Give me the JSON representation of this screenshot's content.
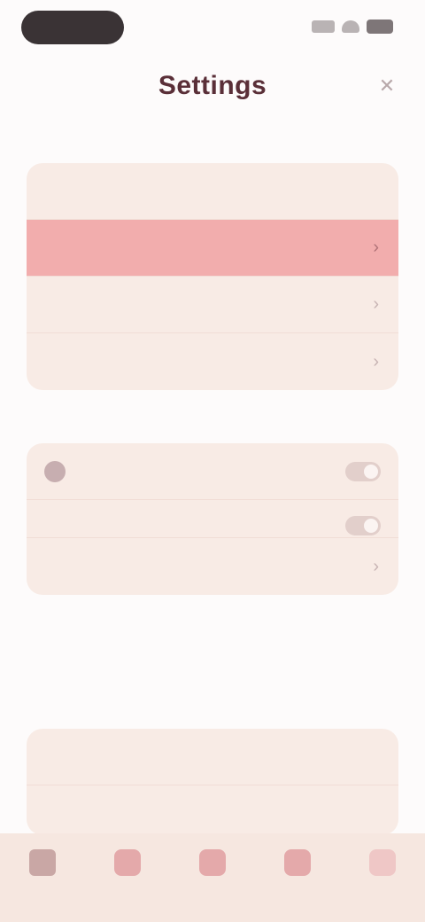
{
  "header": {
    "title": "Settings",
    "action_icon": "close-icon"
  },
  "sections": {
    "account": {
      "label": "",
      "rows": [
        {
          "label": "",
          "icon": ""
        },
        {
          "label": "",
          "selected": true
        },
        {
          "label": ""
        },
        {
          "label": ""
        }
      ]
    },
    "preferences": {
      "label": "",
      "rows": [
        {
          "label": ""
        },
        {
          "label": "",
          "desc": ""
        },
        {
          "label": ""
        }
      ]
    },
    "about": {
      "label": "",
      "rows": [
        {
          "label": "",
          "value": ""
        },
        {
          "label": ""
        }
      ]
    }
  },
  "bottom_nav": {
    "items": [
      {
        "label": "",
        "icon": "home-icon"
      },
      {
        "label": "",
        "icon": "calendar-icon"
      },
      {
        "label": "",
        "icon": "add-icon"
      },
      {
        "label": "",
        "icon": "chat-icon"
      },
      {
        "label": "",
        "icon": "profile-icon"
      }
    ]
  },
  "colors": {
    "accent": "#f2adad",
    "card_bg": "#f8ebe5",
    "title": "#5a2f38"
  }
}
